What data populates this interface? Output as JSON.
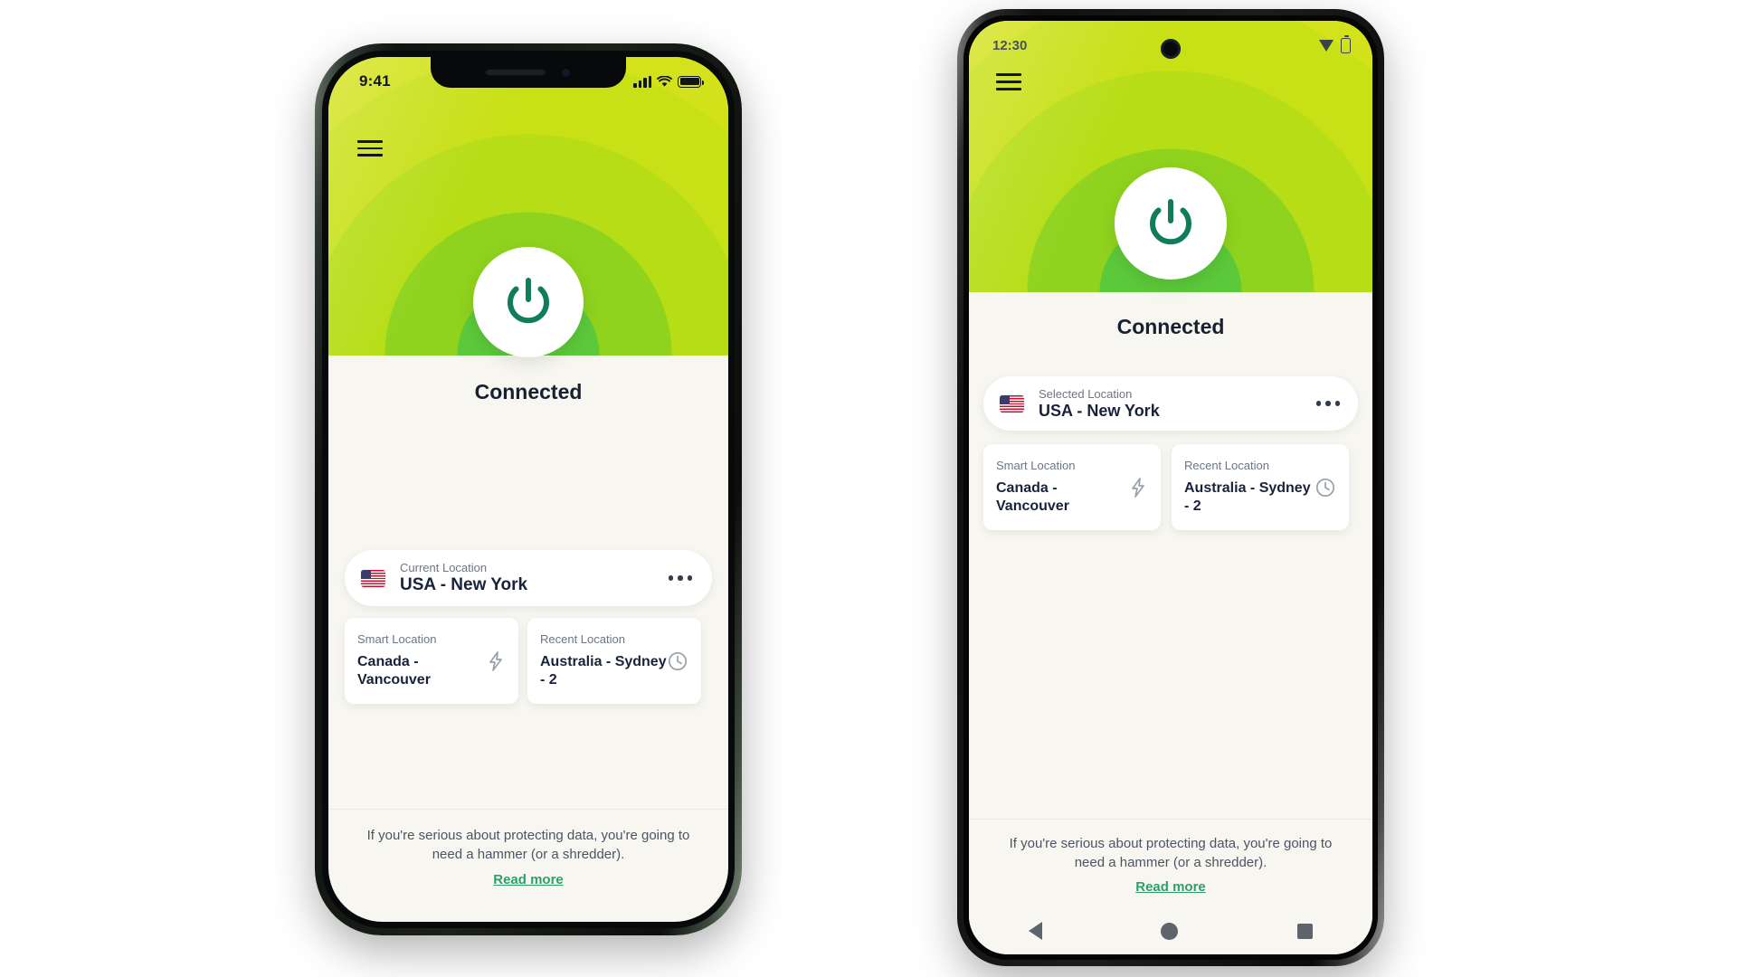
{
  "iphone": {
    "status_bar": {
      "time": "9:41",
      "signal_icon": "cellular-signal-icon",
      "wifi_icon": "wifi-icon",
      "battery_icon": "battery-icon"
    },
    "menu_icon": "hamburger-menu-icon",
    "power_icon": "power-button-icon",
    "status_label": "Connected",
    "primary_location": {
      "caption": "Current Location",
      "value": "USA - New York",
      "flag_icon": "usa-flag-icon",
      "more_icon": "more-options-icon"
    },
    "smart_location": {
      "caption": "Smart Location",
      "value": "Canada - Vancouver",
      "icon": "lightning-bolt-icon"
    },
    "recent_location": {
      "caption": "Recent Location",
      "value": "Australia - Sydney - 2",
      "icon": "clock-icon"
    },
    "footer": {
      "quote": "If you're serious about protecting data, you're going to need a hammer (or a shredder).",
      "link": "Read more"
    }
  },
  "android": {
    "status_bar": {
      "time": "12:30",
      "wifi_icon": "wifi-icon",
      "battery_icon": "battery-icon"
    },
    "menu_icon": "hamburger-menu-icon",
    "power_icon": "power-button-icon",
    "status_label": "Connected",
    "primary_location": {
      "caption": "Selected Location",
      "value": "USA - New York",
      "flag_icon": "usa-flag-icon",
      "more_icon": "more-options-icon"
    },
    "smart_location": {
      "caption": "Smart Location",
      "value": "Canada - Vancouver",
      "icon": "lightning-bolt-icon"
    },
    "recent_location": {
      "caption": "Recent Location",
      "value": "Australia - Sydney - 2",
      "icon": "clock-icon"
    },
    "footer": {
      "quote": "If you're serious about protecting data, you're going to need a hammer (or a shredder).",
      "link": "Read more"
    },
    "nav_bar": {
      "back_icon": "nav-back-icon",
      "home_icon": "nav-home-icon",
      "recents_icon": "nav-recents-icon"
    }
  },
  "colors": {
    "accent_green": "#0f7d5c",
    "link_green": "#2f9f6a",
    "hero_lime": "#cfe119",
    "hero_green": "#5cc93a",
    "screen_bg": "#f7f6f0",
    "text_dark": "#18233a",
    "text_muted": "#6d7683"
  }
}
